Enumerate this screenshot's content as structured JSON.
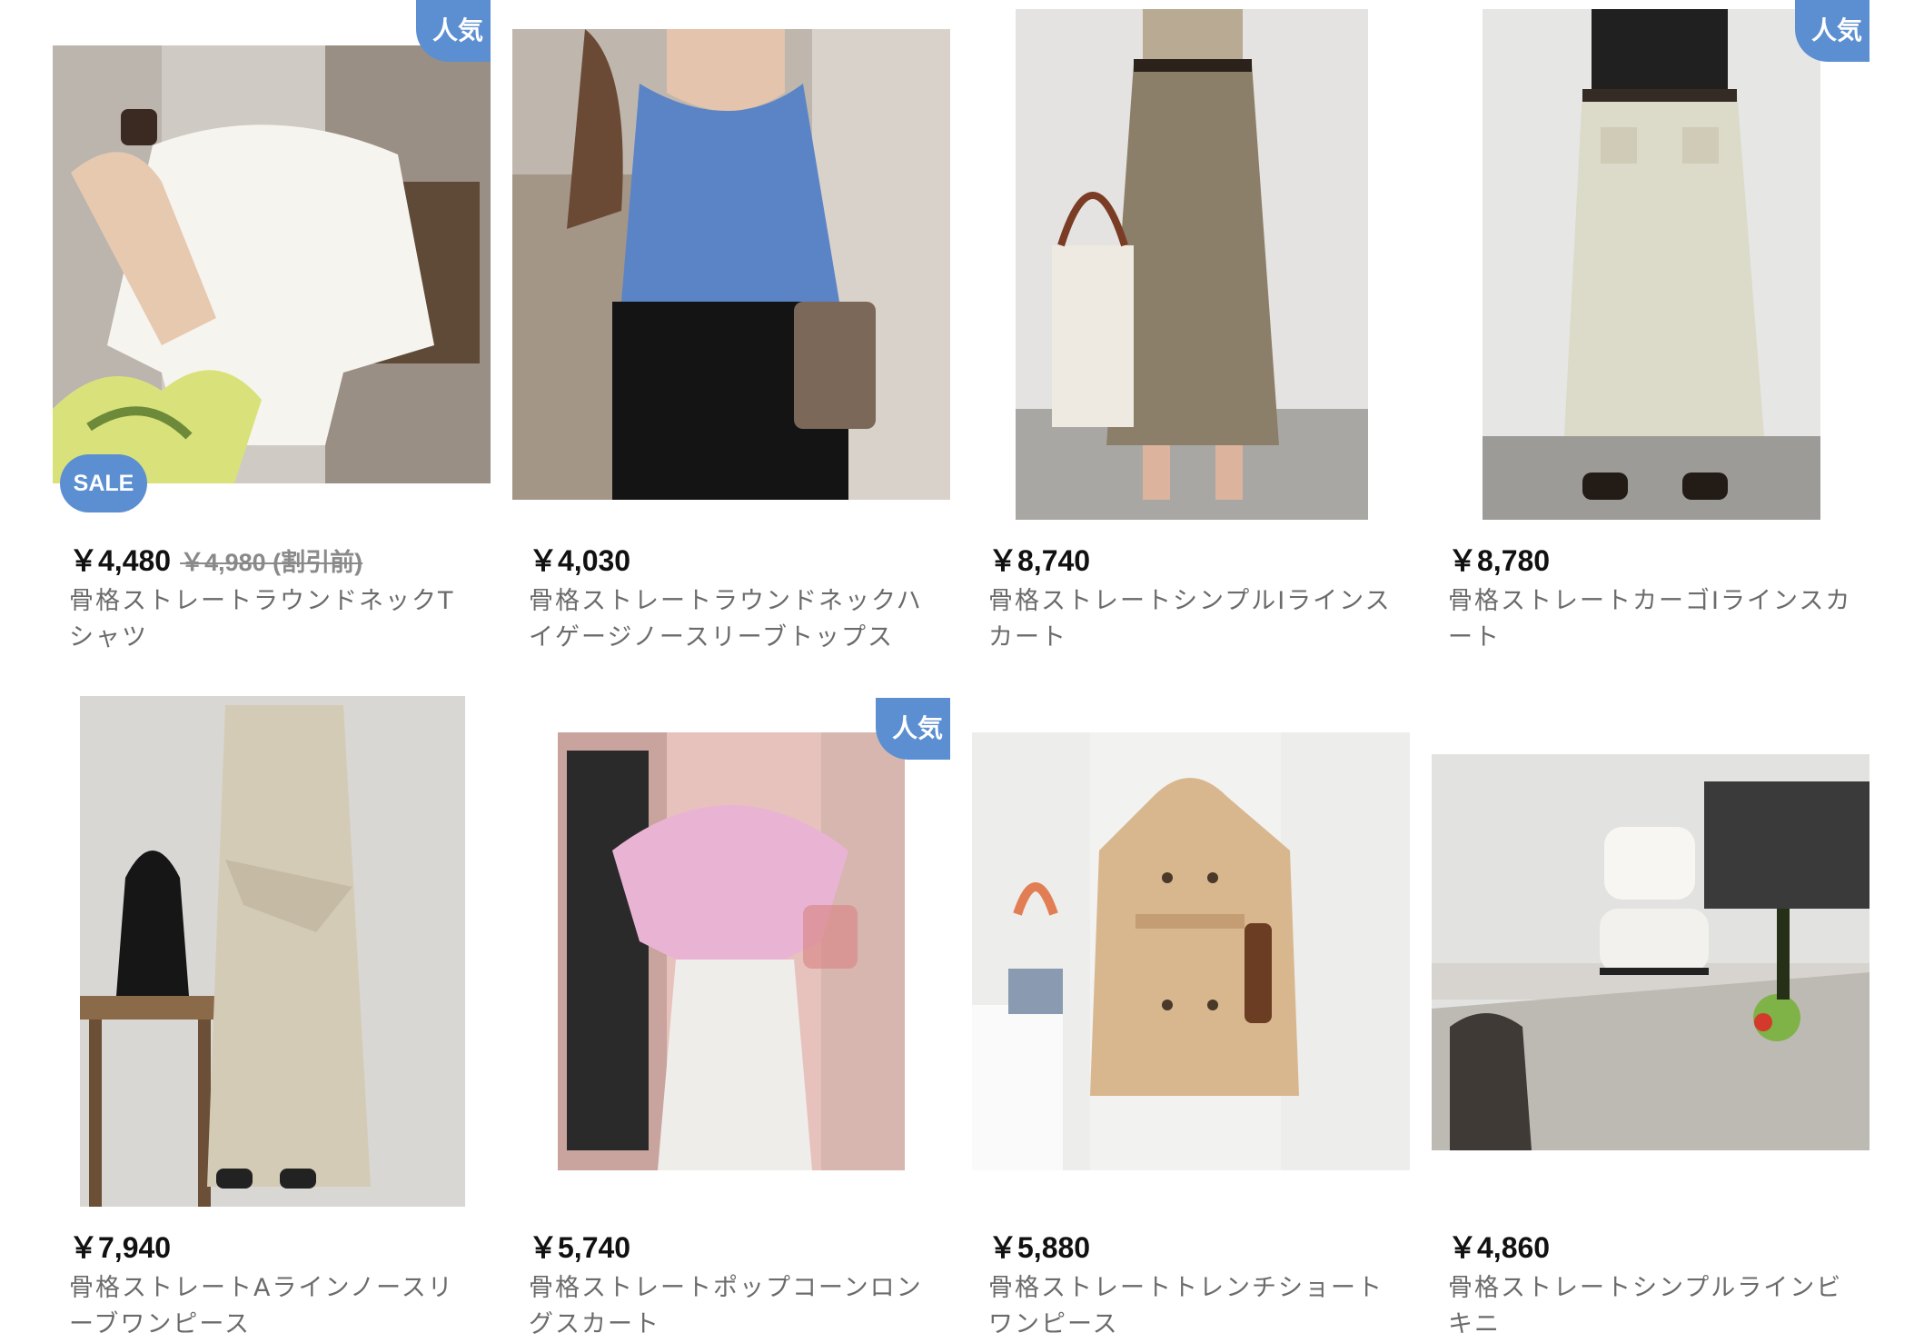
{
  "badges": {
    "popular": "人気",
    "sale": "SALE"
  },
  "products": [
    {
      "price": "￥4,480",
      "old_price": "￥4,980 (割引前)",
      "name": "骨格ストレートラウンドネックTシャツ",
      "popular": true,
      "sale": true
    },
    {
      "price": "￥4,030",
      "old_price": "",
      "name": "骨格ストレートラウンドネックハイゲージノースリーブトップス",
      "popular": false,
      "sale": false
    },
    {
      "price": "￥8,740",
      "old_price": "",
      "name": "骨格ストレートシンプルIラインスカート",
      "popular": false,
      "sale": false
    },
    {
      "price": "￥8,780",
      "old_price": "",
      "name": "骨格ストレートカーゴIラインスカート",
      "popular": true,
      "sale": false
    },
    {
      "price": "￥7,940",
      "old_price": "",
      "name": "骨格ストレートAラインノースリーブワンピース",
      "popular": false,
      "sale": false
    },
    {
      "price": "￥5,740",
      "old_price": "",
      "name": "骨格ストレートポップコーンロングスカート",
      "popular": true,
      "sale": false
    },
    {
      "price": "￥5,880",
      "old_price": "",
      "name": "骨格ストレートトレンチショートワンピース",
      "popular": false,
      "sale": false
    },
    {
      "price": "￥4,860",
      "old_price": "",
      "name": "骨格ストレートシンプルラインビキニ",
      "popular": false,
      "sale": false
    }
  ],
  "colors": {
    "accent": "#5b8fd1",
    "price": "#111111",
    "name": "#6b6b6b",
    "old_price": "#8a8a8a"
  }
}
